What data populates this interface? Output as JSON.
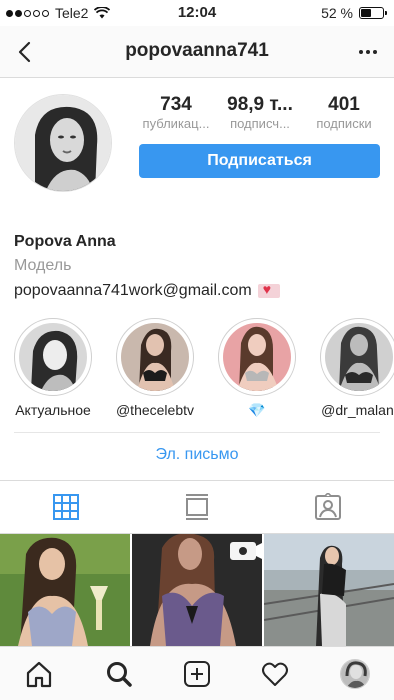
{
  "status_bar": {
    "carrier": "Tele2",
    "time": "12:04",
    "battery": "52 %",
    "battery_level": 0.52,
    "signal_bars_filled": 2
  },
  "nav": {
    "back_icon": "chevron-left-icon",
    "username": "popovaanna741",
    "more_icon": "more-horizontal-icon"
  },
  "profile": {
    "stats": [
      {
        "value": "734",
        "label": "публикац..."
      },
      {
        "value": "98,9 т...",
        "label": "подписч..."
      },
      {
        "value": "401",
        "label": "подписки"
      }
    ],
    "subscribe_label": "Подписаться",
    "name": "Popova Anna",
    "category": "Модель",
    "email": "popovaanna741work@gmail.com"
  },
  "highlights": [
    {
      "label": "Актуальное"
    },
    {
      "label": "@thecelebtv"
    },
    {
      "label": "💎"
    },
    {
      "label": "@dr_malani"
    }
  ],
  "email_button_label": "Эл. письмо",
  "tabs": {
    "grid_icon": "grid-icon",
    "feed_icon": "feed-icon",
    "tagged_icon": "tagged-icon",
    "active_color": "#3897f0"
  },
  "bottom_nav": {
    "items": [
      "home-icon",
      "search-icon",
      "add-icon",
      "heart-icon",
      "profile-avatar"
    ]
  },
  "colors": {
    "accent": "#3897f0",
    "muted": "#999999",
    "text": "#262626"
  }
}
